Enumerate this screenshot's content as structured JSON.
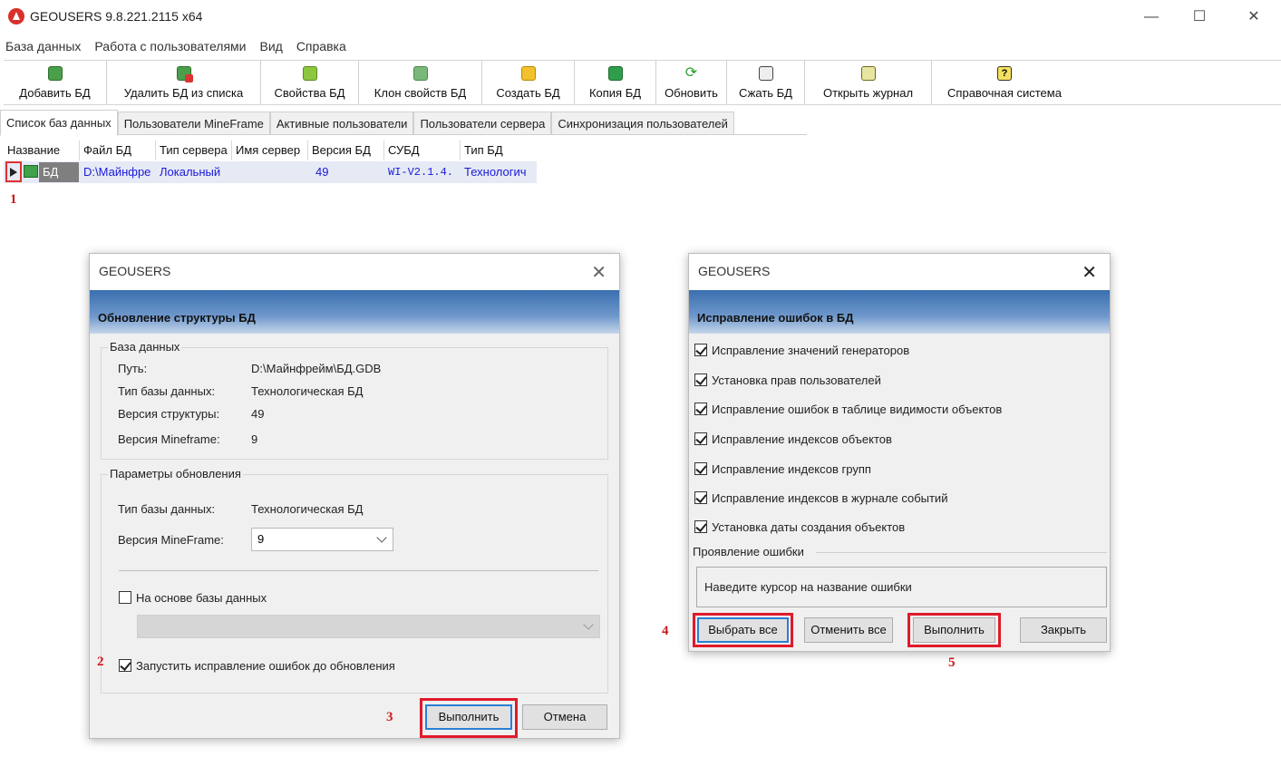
{
  "window": {
    "title": "GEOUSERS 9.8.221.2115 x64",
    "minimize": "—",
    "maximize": "☐",
    "close": "✕"
  },
  "menu": [
    "База данных",
    "Работа с пользователями",
    "Вид",
    "Справка"
  ],
  "toolbar": [
    {
      "label": "Добавить БД",
      "icon": "add-db-icon"
    },
    {
      "label": "Удалить БД из списка",
      "icon": "remove-db-icon"
    },
    {
      "label": "Свойства БД",
      "icon": "db-properties-icon"
    },
    {
      "label": "Клон свойств БД",
      "icon": "clone-properties-icon"
    },
    {
      "label": "Создать БД",
      "icon": "create-db-icon"
    },
    {
      "label": "Копия БД",
      "icon": "copy-db-icon"
    },
    {
      "label": "Обновить",
      "icon": "refresh-icon"
    },
    {
      "label": "Сжать БД",
      "icon": "compress-db-icon"
    },
    {
      "label": "Открыть журнал",
      "icon": "journal-icon"
    },
    {
      "label": "Справочная система",
      "icon": "help-icon"
    }
  ],
  "tabs": [
    "Список баз данных",
    "Пользователи MineFrame",
    "Активные пользователи",
    "Пользователи сервера",
    "Синхронизация пользователей"
  ],
  "grid": {
    "columns": [
      "Название",
      "Файл БД",
      "Тип сервера",
      "Имя сервер",
      "Версия БД",
      "СУБД",
      "Тип БД"
    ],
    "row": {
      "name": "БД",
      "file": "D:\\Майнфре",
      "server_type": "Локальный",
      "server_name": "",
      "version": "49",
      "dbms": "WI-V2.1.4.",
      "db_type": "Технологич"
    }
  },
  "steps": {
    "s1": "1",
    "s2": "2",
    "s3": "3",
    "s4": "4",
    "s5": "5"
  },
  "dialog_update": {
    "title": "GEOUSERS",
    "close": "✕",
    "header": "Обновление структуры БД",
    "db_group": {
      "title": "База данных",
      "path_label": "Путь:",
      "path_value": "D:\\Майнфрейм\\БД.GDB",
      "type_label": "Тип базы данных:",
      "type_value": "Технологическая БД",
      "struct_label": "Версия структуры:",
      "struct_value": "49",
      "mf_label": "Версия Mineframe:",
      "mf_value": "9"
    },
    "params_group": {
      "title": "Параметры обновления",
      "type_label": "Тип базы данных:",
      "type_value": "Технологическая БД",
      "mf_label": "Версия MineFrame:",
      "mf_selected": "9",
      "based_on_label": "На основе базы данных",
      "based_on_checked": false,
      "run_fix_label": "Запустить исправление ошибок до обновления",
      "run_fix_checked": true
    },
    "execute": "Выполнить",
    "cancel": "Отмена"
  },
  "dialog_fix": {
    "title": "GEOUSERS",
    "close": "✕",
    "header": "Исправление ошибок в БД",
    "options": [
      "Исправление значений генераторов",
      "Установка прав пользователей",
      "Исправление ошибок в таблице видимости объектов",
      "Исправление индексов объектов",
      "Исправление индексов групп",
      "Исправление индексов в журнале событий",
      "Установка даты создания объектов"
    ],
    "manifest_title": "Проявление ошибки",
    "manifest_text": "Наведите курсор на название ошибки",
    "select_all": "Выбрать все",
    "deselect_all": "Отменить все",
    "execute": "Выполнить",
    "close_btn": "Закрыть"
  }
}
